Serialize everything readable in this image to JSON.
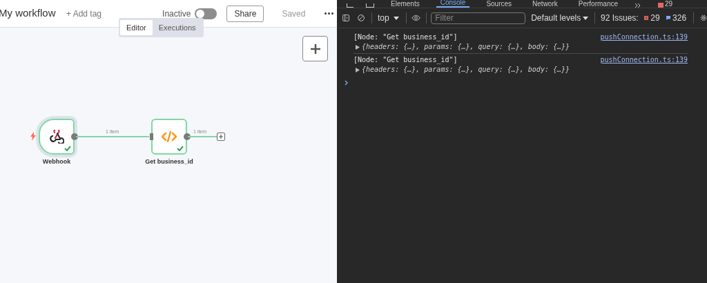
{
  "workflow": {
    "name": "My workflow",
    "add_tag": "+ Add tag",
    "status_label": "Inactive",
    "active": false,
    "share": "Share",
    "save_state": "Saved"
  },
  "view_tabs": [
    {
      "label": "Editor",
      "selected": true
    },
    {
      "label": "Executions",
      "selected": false
    }
  ],
  "canvas": {
    "nodes": [
      {
        "kind": "webhook",
        "label": "Webhook",
        "trigger": true,
        "success": true
      },
      {
        "kind": "code",
        "label": "Get business_id",
        "trigger": false,
        "success": true
      }
    ],
    "connections": [
      {
        "label": "1 item"
      },
      {
        "label": "1 item"
      }
    ]
  },
  "devtools": {
    "tabs": [
      {
        "label": "Elements",
        "selected": false
      },
      {
        "label": "Console",
        "selected": true
      },
      {
        "label": "Sources",
        "selected": false
      },
      {
        "label": "Network",
        "selected": false
      },
      {
        "label": "Performance",
        "selected": false
      }
    ],
    "error_count": "29",
    "context": "top",
    "filter_placeholder": "Filter",
    "levels": "Default levels",
    "issues_label": "92 Issues:",
    "issue_errors": "29",
    "issue_infos": "326",
    "messages": [
      {
        "text": "[Node: \"Get business_id\"]",
        "source": "pushConnection.ts:139",
        "preview": "{headers: {…}, params: {…}, query: {…}, body: {…}}"
      },
      {
        "text": "[Node: \"Get business_id\"]",
        "source": "pushConnection.ts:139",
        "preview": "{headers: {…}, params: {…}, query: {…}, body: {…}}"
      }
    ]
  }
}
